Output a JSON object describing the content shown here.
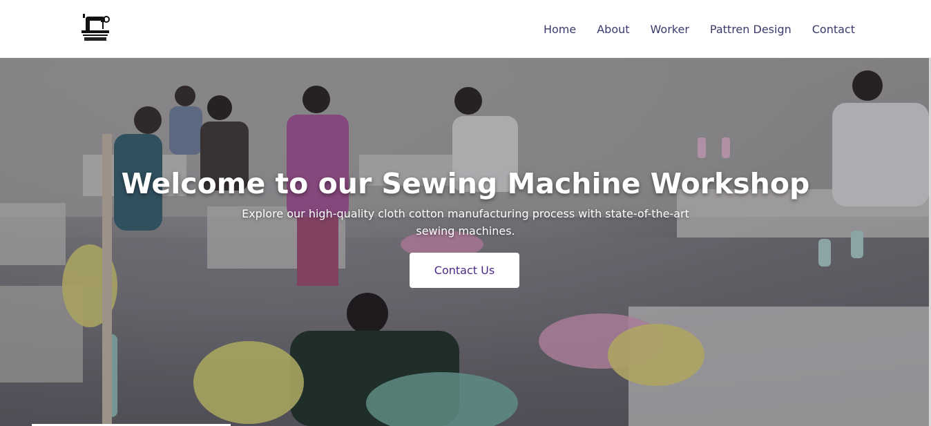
{
  "nav": {
    "logo_icon": "sewing-machine-icon",
    "links": [
      {
        "label": "Home"
      },
      {
        "label": "About"
      },
      {
        "label": "Worker"
      },
      {
        "label": "Pattren Design"
      },
      {
        "label": "Contact"
      }
    ]
  },
  "hero": {
    "title": "Welcome to our Sewing Machine Workshop",
    "subtitle": "Explore our high-quality cloth cotton manufacturing process with state-of-the-art sewing machines.",
    "cta_label": "Contact Us"
  },
  "colors": {
    "nav_text": "#3a3a6a",
    "cta_text": "#4b2a86",
    "hero_text": "#ffffff"
  }
}
